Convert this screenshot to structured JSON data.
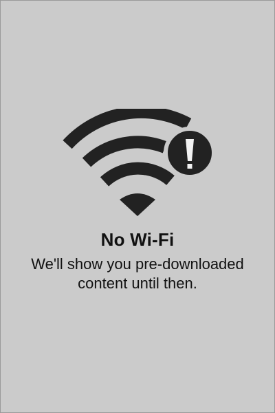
{
  "status": {
    "icon": "wifi-warning-icon",
    "title": "No Wi-Fi",
    "message": "We'll show you pre-downloaded content until then."
  },
  "colors": {
    "background": "#cbcbcb",
    "icon": "#222222",
    "text": "#111111"
  }
}
